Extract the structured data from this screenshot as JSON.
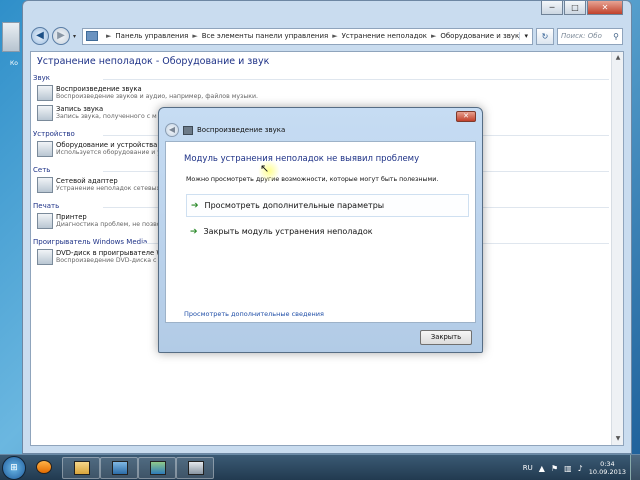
{
  "desktop": {
    "label": "Ко"
  },
  "window": {
    "caption_buttons": {
      "minimize": "─",
      "maximize": "□",
      "close": "✕"
    },
    "nav": {
      "back": "◀",
      "forward": "▶",
      "dropdown": "▾"
    },
    "breadcrumbs": [
      "Панель управления",
      "Все элементы панели управления",
      "Устранение неполадок",
      "Оборудование и звук"
    ],
    "breadcrumb_separator": "►",
    "address_dropdown": "▾",
    "refresh": "↻",
    "search": {
      "placeholder": "Поиск: Обо",
      "icon": "⚲"
    },
    "pane_title": "Устранение неполадок - Оборудование и звук",
    "categories": [
      {
        "label": "Звук",
        "items": [
          {
            "title": "Воспроизведение звука",
            "desc": "Воспроизведение звуков и аудио, например, файлов музыки."
          },
          {
            "title": "Запись звука",
            "desc": "Запись звука, полученного с м"
          }
        ]
      },
      {
        "label": "Устройство",
        "items": [
          {
            "title": "Оборудование и устройства",
            "desc": "Используется оборудование и устр"
          }
        ]
      },
      {
        "label": "Сеть",
        "items": [
          {
            "title": "Сетевой адаптер",
            "desc": "Устранение неполадок сетевых ад"
          }
        ]
      },
      {
        "label": "Печать",
        "items": [
          {
            "title": "Принтер",
            "desc": "Диагностика проблем, не позволяющ"
          }
        ]
      },
      {
        "label": "Проигрыватель Windows Media",
        "items": [
          {
            "title": "DVD-диск в проигрывателе Windo",
            "desc": "Воспроизведение DVD-диска с по"
          }
        ]
      }
    ],
    "scroll": {
      "up": "▲",
      "down": "▼"
    }
  },
  "dialog": {
    "title": "Воспроизведение звука",
    "back": "◀",
    "close": "✕",
    "heading": "Модуль устранения неполадок не выявил проблему",
    "subtext": "Можно просмотреть другие возможности, которые могут быть полезными.",
    "options": [
      {
        "arrow": "➔",
        "label": "Просмотреть дополнительные параметры"
      },
      {
        "arrow": "➔",
        "label": "Закрыть модуль устранения неполадок"
      }
    ],
    "details_link": "Просмотреть дополнительные сведения",
    "close_button": "Закрыть"
  },
  "cursor": "↖",
  "taskbar": {
    "start": "⊞",
    "buttons": [
      "start-button",
      "media-player",
      "explorer",
      "image-viewer",
      "control-panel",
      "troubleshooter"
    ],
    "tray": {
      "language": "RU",
      "expand": "▲",
      "flag": "⚑",
      "network": "▥",
      "volume": "♪",
      "time": "0:34",
      "date": "10.09.2013"
    }
  },
  "colors": {
    "accent_blue": "#1e3287",
    "link_blue": "#1f4ea7",
    "arrow_green": "#2c8a2a",
    "close_red": "#c2412b",
    "taskbar": "#2f4a62"
  }
}
